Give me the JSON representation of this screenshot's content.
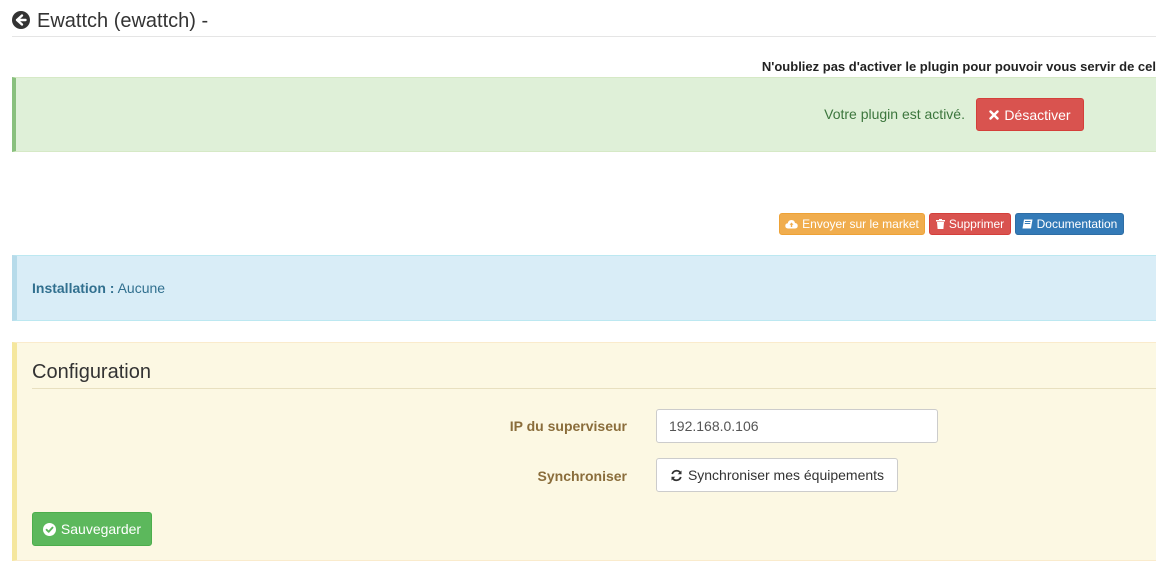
{
  "header": {
    "title": "Ewattch (ewattch) -"
  },
  "notice": "N'oubliez pas d'activer le plugin pour pouvoir vous servir de cel",
  "activation": {
    "status_text": "Votre plugin est activé.",
    "deactivate_label": "Désactiver"
  },
  "actions": {
    "market_label": "Envoyer sur le market",
    "delete_label": "Supprimer",
    "doc_label": "Documentation"
  },
  "installation": {
    "label": "Installation :",
    "value": "Aucune"
  },
  "configuration": {
    "title": "Configuration",
    "ip_label": "IP du superviseur",
    "ip_value": "192.168.0.106",
    "sync_label": "Synchroniser",
    "sync_button": "Synchroniser mes équipements",
    "save_button": "Sauvegarder"
  },
  "colors": {
    "success_bg": "#dff0d8",
    "danger": "#d9534f",
    "warning": "#f0ad4e",
    "primary": "#337ab7",
    "info_bg": "#d9edf7",
    "config_bg": "#fcf8e3",
    "save": "#5cb85c"
  }
}
